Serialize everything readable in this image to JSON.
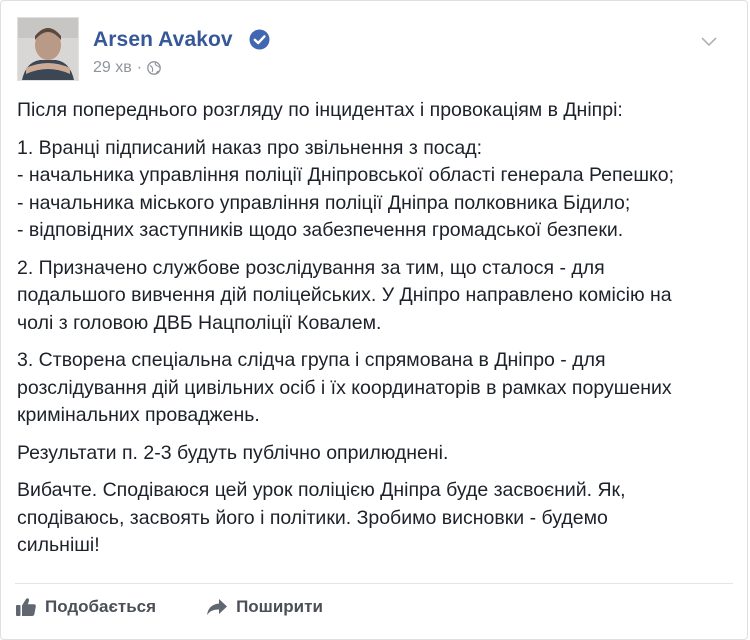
{
  "post": {
    "author": "Arsen Avakov",
    "time": "29 хв",
    "separator": "·",
    "paragraphs": [
      [
        "Після попереднього розгляду по інцидентах і провокаціям в Дніпрі:"
      ],
      [
        "1. Вранці підписаний наказ про звільнення з посад:",
        "- начальника управління поліції Дніпровської області генерала Репешко;",
        "- начальника міського управління поліції Дніпра полковника Бідило;",
        "- відповідних заступників щодо забезпечення громадської безпеки."
      ],
      [
        "2. Призначено службове розслідування за тим, що сталося - для",
        "подальшого вивчення дій поліцейських. У Дніпро направлено комісію на",
        "чолі з головою ДВБ Нацполіції Ковалем."
      ],
      [
        "3. Створена спеціальна слідча група і спрямована в Дніпро - для",
        "розслідування дій цивільних осіб і їх координаторів в рамках порушених",
        "кримінальних проваджень."
      ],
      [
        "Результати п. 2-3 будуть публічно оприлюднені."
      ],
      [
        "Вибачте. Сподіваюся цей урок поліцією Дніпра буде засвоєний. Як,",
        "сподіваюсь, засвоять його і політики. Зробимо висновки - будемо",
        "сильніші!"
      ]
    ]
  },
  "actions": {
    "like_label": "Подобається",
    "share_label": "Поширити"
  },
  "colors": {
    "name": "#365899",
    "meta": "#90949c",
    "text": "#1d2129",
    "action": "#4b4f56",
    "verified": "#4267b2"
  },
  "icons": {
    "verified": "verified-badge-icon",
    "audience": "globe-icon",
    "menu": "chevron-down-icon",
    "like": "thumbs-up-icon",
    "share": "share-arrow-icon"
  }
}
